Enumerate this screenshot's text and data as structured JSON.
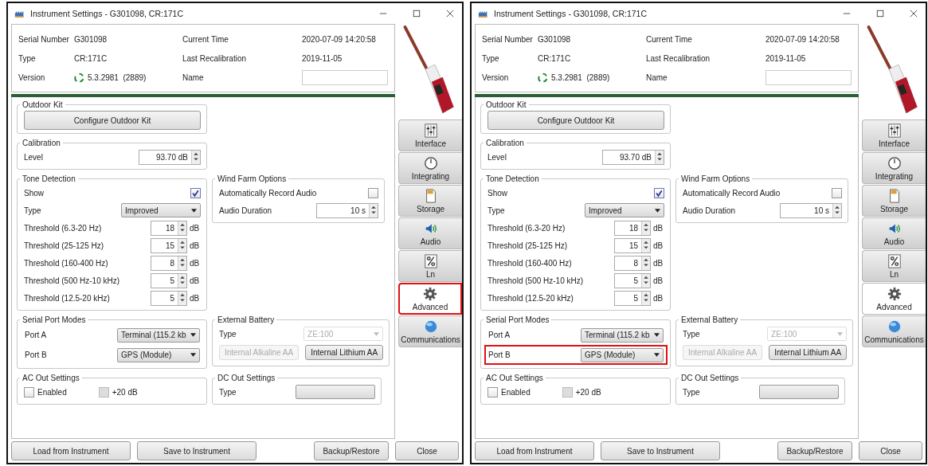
{
  "windows": [
    {
      "title": "Instrument Settings - G301098, CR:171C",
      "info": [
        {
          "kind": "text",
          "label": "Serial Number",
          "value": "G301098"
        },
        {
          "kind": "text",
          "label": "Current Time",
          "value": "2020-07-09 14:20:58"
        },
        {
          "kind": "text",
          "label": "Type",
          "value": "CR:171C"
        },
        {
          "kind": "text",
          "label": "Last Recalibration",
          "value": "2019-11-05"
        },
        {
          "kind": "version",
          "label": "Version",
          "value": "5.3.2981  (2889)"
        },
        {
          "kind": "field",
          "label": "Name"
        }
      ],
      "outdoor_kit": {
        "title": "Outdoor Kit",
        "button": "Configure Outdoor Kit"
      },
      "calibration": {
        "title": "Calibration",
        "label": "Level",
        "value": "93.70 dB"
      },
      "tone_detection": {
        "title": "Tone Detection",
        "show": {
          "label": "Show",
          "checked": true
        },
        "type": {
          "label": "Type",
          "value": "Improved"
        },
        "thresholds": [
          {
            "label": "Threshold (6.3-20 Hz)",
            "value": "18",
            "unit": "dB"
          },
          {
            "label": "Threshold (25-125 Hz)",
            "value": "15",
            "unit": "dB"
          },
          {
            "label": "Threshold (160-400 Hz)",
            "value": "8",
            "unit": "dB"
          },
          {
            "label": "Threshold (500 Hz-10 kHz)",
            "value": "5",
            "unit": "dB"
          },
          {
            "label": "Threshold (12.5-20 kHz)",
            "value": "5",
            "unit": "dB"
          }
        ]
      },
      "wind_farm": {
        "title": "Wind Farm Options",
        "auto_record": {
          "label": "Automatically Record Audio",
          "checked": false
        },
        "duration": {
          "label": "Audio Duration",
          "value": "10 s"
        }
      },
      "serial_ports": {
        "title": "Serial Port Modes",
        "ports": [
          {
            "label": "Port A",
            "value": "Terminal (115.2 kb",
            "highlighted": false
          },
          {
            "label": "Port B",
            "value": "GPS (Module)",
            "highlighted": false
          }
        ]
      },
      "external_battery": {
        "title": "External Battery",
        "type": {
          "label": "Type",
          "value": "ZE:100",
          "disabled": true
        },
        "buttons": [
          {
            "label": "Internal Alkaline AA",
            "disabled": true
          },
          {
            "label": "Internal Lithium AA",
            "disabled": false
          }
        ]
      },
      "ac_out": {
        "title": "AC Out Settings",
        "options": [
          {
            "label": "Enabled",
            "checked": false,
            "disabled": false
          },
          {
            "label": "+20 dB",
            "checked": false,
            "disabled": true
          }
        ]
      },
      "dc_out": {
        "title": "DC Out Settings",
        "type_label": "Type"
      },
      "tabs": [
        {
          "label": "Interface",
          "selected": false,
          "highlighted": false
        },
        {
          "label": "Integrating",
          "selected": false,
          "highlighted": false
        },
        {
          "label": "Storage",
          "selected": false,
          "highlighted": false
        },
        {
          "label": "Audio",
          "selected": false,
          "highlighted": false
        },
        {
          "label": "Ln",
          "selected": false,
          "highlighted": false
        },
        {
          "label": "Advanced",
          "selected": true,
          "highlighted": true
        },
        {
          "label": "Communications",
          "selected": false,
          "highlighted": false
        }
      ],
      "buttons": [
        "Load from Instrument",
        "Save to Instrument",
        "Backup/Restore",
        "Close"
      ]
    },
    {
      "title": "Instrument Settings - G301098, CR:171C",
      "info": [
        {
          "kind": "text",
          "label": "Serial Number",
          "value": "G301098"
        },
        {
          "kind": "text",
          "label": "Current Time",
          "value": "2020-07-09 14:20:58"
        },
        {
          "kind": "text",
          "label": "Type",
          "value": "CR:171C"
        },
        {
          "kind": "text",
          "label": "Last Recalibration",
          "value": "2019-11-05"
        },
        {
          "kind": "version",
          "label": "Version",
          "value": "5.3.2981  (2889)"
        },
        {
          "kind": "field",
          "label": "Name"
        }
      ],
      "outdoor_kit": {
        "title": "Outdoor Kit",
        "button": "Configure Outdoor Kit"
      },
      "calibration": {
        "title": "Calibration",
        "label": "Level",
        "value": "93.70 dB"
      },
      "tone_detection": {
        "title": "Tone Detection",
        "show": {
          "label": "Show",
          "checked": true
        },
        "type": {
          "label": "Type",
          "value": "Improved"
        },
        "thresholds": [
          {
            "label": "Threshold (6.3-20 Hz)",
            "value": "18",
            "unit": "dB"
          },
          {
            "label": "Threshold (25-125 Hz)",
            "value": "15",
            "unit": "dB"
          },
          {
            "label": "Threshold (160-400 Hz)",
            "value": "8",
            "unit": "dB"
          },
          {
            "label": "Threshold (500 Hz-10 kHz)",
            "value": "5",
            "unit": "dB"
          },
          {
            "label": "Threshold (12.5-20 kHz)",
            "value": "5",
            "unit": "dB"
          }
        ]
      },
      "wind_farm": {
        "title": "Wind Farm Options",
        "auto_record": {
          "label": "Automatically Record Audio",
          "checked": false
        },
        "duration": {
          "label": "Audio Duration",
          "value": "10 s"
        }
      },
      "serial_ports": {
        "title": "Serial Port Modes",
        "ports": [
          {
            "label": "Port A",
            "value": "Terminal (115.2 kb",
            "highlighted": false
          },
          {
            "label": "Port B",
            "value": "GPS (Module)",
            "highlighted": true
          }
        ]
      },
      "external_battery": {
        "title": "External Battery",
        "type": {
          "label": "Type",
          "value": "ZE:100",
          "disabled": true
        },
        "buttons": [
          {
            "label": "Internal Alkaline AA",
            "disabled": true
          },
          {
            "label": "Internal Lithium AA",
            "disabled": false
          }
        ]
      },
      "ac_out": {
        "title": "AC Out Settings",
        "options": [
          {
            "label": "Enabled",
            "checked": false,
            "disabled": false
          },
          {
            "label": "+20 dB",
            "checked": false,
            "disabled": true
          }
        ]
      },
      "dc_out": {
        "title": "DC Out Settings",
        "type_label": "Type"
      },
      "tabs": [
        {
          "label": "Interface",
          "selected": false,
          "highlighted": false
        },
        {
          "label": "Integrating",
          "selected": false,
          "highlighted": false
        },
        {
          "label": "Storage",
          "selected": false,
          "highlighted": false
        },
        {
          "label": "Audio",
          "selected": false,
          "highlighted": false
        },
        {
          "label": "Ln",
          "selected": false,
          "highlighted": false
        },
        {
          "label": "Advanced",
          "selected": true,
          "highlighted": false
        },
        {
          "label": "Communications",
          "selected": false,
          "highlighted": false
        }
      ],
      "buttons": [
        "Load from Instrument",
        "Save to Instrument",
        "Backup/Restore",
        "Close"
      ]
    }
  ]
}
